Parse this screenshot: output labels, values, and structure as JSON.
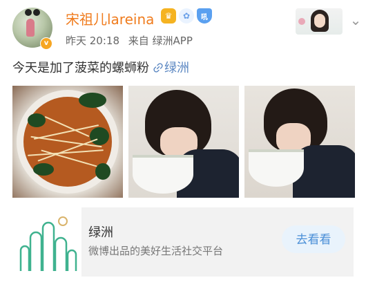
{
  "post": {
    "username": "宋祖儿lareina",
    "time": "昨天 20:18",
    "source": "来自 绿洲APP",
    "text": "今天是加了菠菜的螺蛳粉",
    "link_icon": "link-icon",
    "link_text": "绿洲",
    "badges": [
      "crown-badge-icon",
      "bunny-badge-icon",
      "shield-badge-icon"
    ],
    "shield_badge_text": "吼",
    "verified_mark": "v"
  },
  "card": {
    "title": "绿洲",
    "subtitle": "微博出品的美好生活社交平台",
    "button": "去看看"
  },
  "colors": {
    "username": "#f07c1e",
    "link": "#5b87c2",
    "button_bg": "#e9f3fc",
    "button_text": "#4a8fd7",
    "logo_green": "#3fb28f",
    "logo_ring": "#d9b36a"
  }
}
